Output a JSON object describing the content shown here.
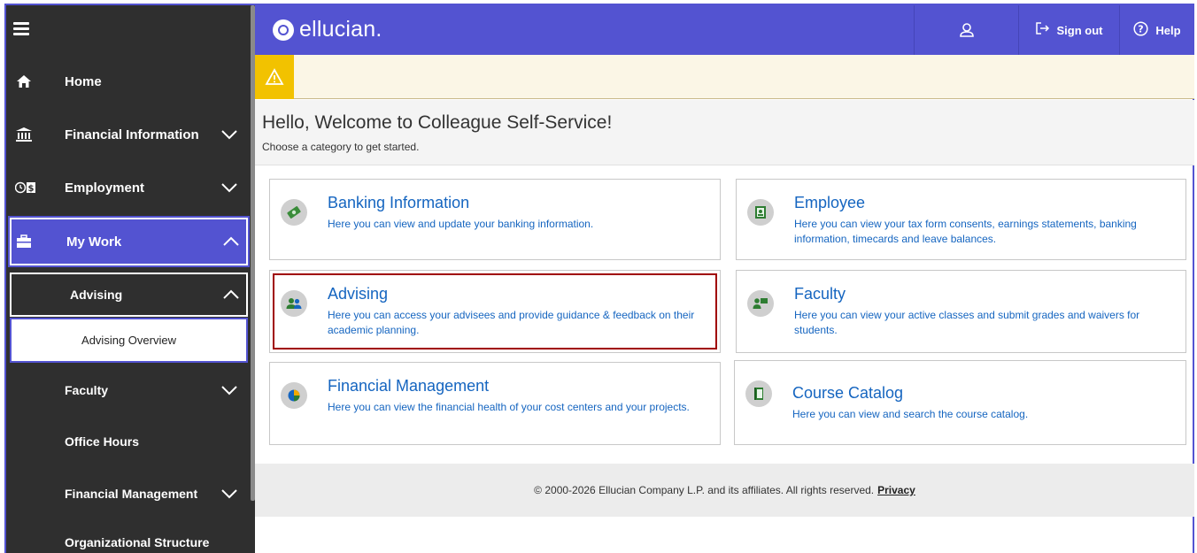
{
  "header": {
    "brand": "ellucian.",
    "signout_label": "Sign out",
    "help_label": "Help"
  },
  "sidebar": {
    "items": [
      {
        "label": "Home",
        "icon": "home-icon"
      },
      {
        "label": "Financial Information",
        "icon": "bank-icon"
      },
      {
        "label": "Employment",
        "icon": "timecard-icon"
      },
      {
        "label": "My Work",
        "icon": "briefcase-icon"
      },
      {
        "label": "Advising"
      },
      {
        "label": "Advising Overview"
      },
      {
        "label": "Faculty"
      },
      {
        "label": "Office Hours"
      },
      {
        "label": "Financial Management"
      },
      {
        "label": "Organizational Structure"
      }
    ]
  },
  "welcome": {
    "title": "Hello, Welcome to Colleague Self-Service!",
    "subtitle": "Choose a category to get started."
  },
  "cards": [
    {
      "title": "Banking Information",
      "desc": "Here you can view and update your banking information.",
      "icon": "money-icon"
    },
    {
      "title": "Employee",
      "desc": "Here you can view your tax form consents, earnings statements, banking information, timecards and leave balances.",
      "icon": "id-badge-icon"
    },
    {
      "title": "Advising",
      "desc": "Here you can access your advisees and provide guidance & feedback on their academic planning.",
      "icon": "people-icon"
    },
    {
      "title": "Faculty",
      "desc": "Here you can view your active classes and submit grades and waivers for students.",
      "icon": "teacher-icon"
    },
    {
      "title": "Financial Management",
      "desc": "Here you can view the financial health of your cost centers and your projects.",
      "icon": "pie-chart-icon"
    },
    {
      "title": "Course Catalog",
      "desc": "Here you can view and search the course catalog.",
      "icon": "book-icon"
    }
  ],
  "footer": {
    "text": "© 2000-2026 Ellucian Company L.P. and its affiliates. All rights reserved.",
    "privacy_label": "Privacy"
  },
  "colors": {
    "brand": "#5353d1",
    "sidebar_bg": "#2f2f2f",
    "link": "#1565c0",
    "alert": "#f2c200",
    "highlight": "#a00000"
  }
}
